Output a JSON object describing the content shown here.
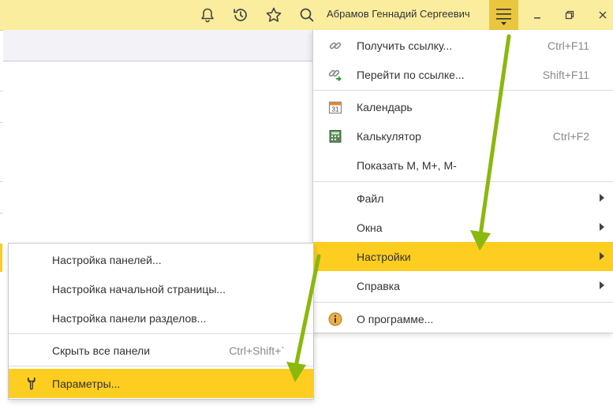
{
  "header": {
    "user_name": "Абрамов Геннадий Сергеевич",
    "icons": [
      "bell-icon",
      "history-icon",
      "star-icon",
      "search-icon",
      "hamburger-menu-icon",
      "minimize-icon",
      "restore-icon",
      "close-icon"
    ]
  },
  "main_menu": {
    "items": [
      {
        "label": "Получить ссылку...",
        "shortcut": "Ctrl+F11",
        "icon": "link-icon"
      },
      {
        "label": "Перейти по ссылке...",
        "shortcut": "Shift+F11",
        "icon": "goto-link-icon"
      },
      {
        "label": "Календарь",
        "icon": "calendar-icon",
        "icon_text": "31"
      },
      {
        "label": "Калькулятор",
        "shortcut": "Ctrl+F2",
        "icon": "calculator-icon"
      },
      {
        "label": "Показать M, M+, M-"
      },
      {
        "label": "Файл",
        "submenu": true
      },
      {
        "label": "Окна",
        "submenu": true
      },
      {
        "label": "Настройки",
        "submenu": true,
        "highlighted": true
      },
      {
        "label": "Справка",
        "submenu": true
      },
      {
        "label": "О программе...",
        "icon": "info-icon"
      }
    ]
  },
  "settings_submenu": {
    "items": [
      {
        "label": "Настройка панелей..."
      },
      {
        "label": "Настройка начальной страницы..."
      },
      {
        "label": "Настройка панели разделов..."
      },
      {
        "label": "Скрыть все панели",
        "shortcut": "Ctrl+Shift+`"
      },
      {
        "label": "Параметры...",
        "icon": "wrench-icon",
        "highlighted": true
      }
    ]
  },
  "colors": {
    "header_bg": "#fbed9e",
    "highlight": "#fdcd1f",
    "active_button": "#e9c63e",
    "annotation_arrow": "#8ab80d"
  }
}
